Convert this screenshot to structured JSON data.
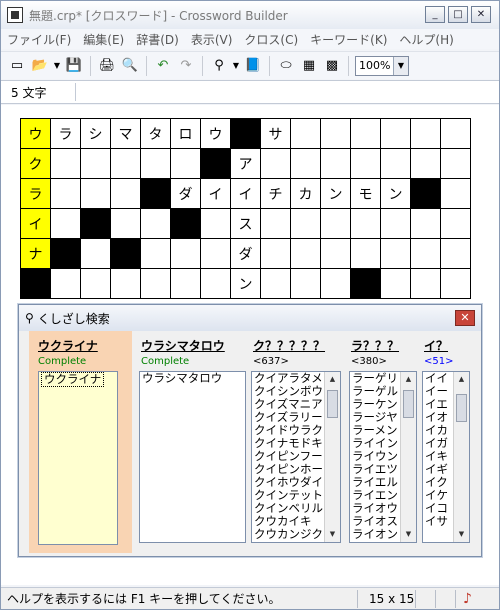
{
  "window": {
    "title": "無題.crp* [クロスワード] - Crossword Builder"
  },
  "menu": [
    "ファイル(F)",
    "編集(E)",
    "辞書(D)",
    "表示(V)",
    "クロス(C)",
    "キーワード(K)",
    "ヘルプ(H)"
  ],
  "toolbar": {
    "zoom": "100%"
  },
  "info": {
    "char_count": "5 文字"
  },
  "grid": [
    [
      "ウ",
      "ラ",
      "シ",
      "マ",
      "タ",
      "ロ",
      "ウ",
      "#",
      "サ",
      "",
      "",
      "",
      "",
      "",
      ""
    ],
    [
      "ク",
      "",
      "",
      "",
      "",
      "",
      "#",
      "ア",
      "",
      "",
      "",
      "",
      "",
      "",
      ""
    ],
    [
      "ラ",
      "",
      "",
      "",
      "#",
      "ダ",
      "イ",
      "イ",
      "チ",
      "カ",
      "ン",
      "モ",
      "ン",
      "#",
      ""
    ],
    [
      "イ",
      "",
      "#",
      "",
      "",
      "#",
      "",
      "ス",
      "",
      "",
      "",
      "",
      "",
      "",
      ""
    ],
    [
      "ナ",
      "#",
      "",
      "#",
      "",
      "",
      "",
      "ダ",
      "",
      "",
      "",
      "",
      "",
      "",
      ""
    ],
    [
      "#",
      "",
      "",
      "",
      "",
      "",
      "",
      "ン",
      "",
      "",
      "",
      "#",
      "",
      "",
      ""
    ]
  ],
  "highlight_col": 0,
  "highlight_rows": 5,
  "dialog": {
    "title": "くしざし検索",
    "columns": [
      {
        "header": "ウクライナ",
        "status": "Complete",
        "items": [
          "ウクライナ"
        ]
      },
      {
        "header": "ウラシマタロウ",
        "status": "Complete",
        "items": [
          "ウラシマタロウ"
        ]
      },
      {
        "header": "ク？？？？？",
        "status": "<637>",
        "items": [
          "クイアラタメ",
          "クイシンボウ",
          "クイズマニア",
          "クイズラリー",
          "クイドウラク",
          "クイナモドキ",
          "クイピンフー",
          "クイピンホー",
          "クイホウダイ",
          "クインテット",
          "クインベリル",
          "クウカイキ",
          "クウカンジク"
        ]
      },
      {
        "header": "ラ？？？",
        "status": "<380>",
        "items": [
          "ラーゲリ",
          "ラーゲル",
          "ラーケン",
          "ラージヤ",
          "ラーメン",
          "ライイン",
          "ライウン",
          "ライエツ",
          "ライエル",
          "ライエン",
          "ライオウ",
          "ライオス",
          "ライオン"
        ]
      },
      {
        "header": "イ？",
        "status": "<51>",
        "items": [
          "イイ",
          "イー",
          "イエ",
          "イオ",
          "イカ",
          "イガ",
          "イキ",
          "イギ",
          "イク",
          "イケ",
          "イコ",
          "イサ"
        ]
      }
    ]
  },
  "status": {
    "help": "ヘルプを表示するには F1 キーを押してください。",
    "size": "15 x 15"
  },
  "colors": {
    "highlight": "#ffff00",
    "first_col_bg": "#f9d4b3",
    "status_green": "#008000",
    "status_blue": "#0000ff"
  }
}
